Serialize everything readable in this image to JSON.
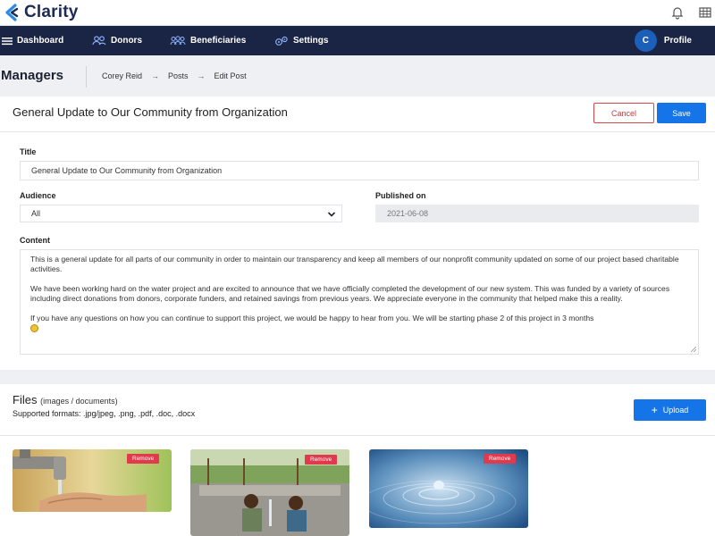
{
  "app": {
    "name": "Clarity"
  },
  "nav": {
    "items": [
      {
        "label": "Dashboard",
        "icon": "menu-icon"
      },
      {
        "label": "Donors",
        "icon": "users-icon"
      },
      {
        "label": "Beneficiaries",
        "icon": "group-icon"
      },
      {
        "label": "Settings",
        "icon": "gears-icon"
      }
    ],
    "profile": {
      "initial": "C",
      "label": "Profile"
    }
  },
  "page": {
    "title": "Managers",
    "breadcrumb": [
      "Corey Reid",
      "Posts",
      "Edit Post"
    ]
  },
  "post": {
    "heading": "General Update to Our Community from Organization",
    "cancel_label": "Cancel",
    "save_label": "Save",
    "title_label": "Title",
    "title_value": "General Update  to Our Community from Organization",
    "audience_label": "Audience",
    "audience_value": "All",
    "published_label": "Published on",
    "published_value": "2021-06-08",
    "content_label": "Content",
    "content_paragraphs": [
      "This is a general update for all parts of our community in order to maintain our transparency and keep all members of our nonprofit community updated on some of our project based charitable activities.",
      "We have been working hard on the water project and are excited to announce that we have officially completed the development of our new system. This was funded by a variety of sources including direct donations from donors, corporate funders, and retained savings from previous years. We appreciate everyone in the community that helped make this a reality.",
      "If you have any questions on how you can continue to support this project, we would be happy to hear from you. We will be starting phase 2 of this project in 3 months"
    ]
  },
  "files": {
    "title": "Files",
    "subtitle": "(images / documents)",
    "formats": "Supported formats: .jpg/jpeg, .png, .pdf, .doc, .docx",
    "upload_label": "Upload",
    "remove_label": "Remove",
    "images": [
      "faucet-hands-image",
      "children-water-image",
      "water-drop-image"
    ]
  },
  "colors": {
    "nav_bg": "#1a2545",
    "primary": "#1474e8",
    "danger": "#d04a4a",
    "remove": "#e03a4c"
  }
}
